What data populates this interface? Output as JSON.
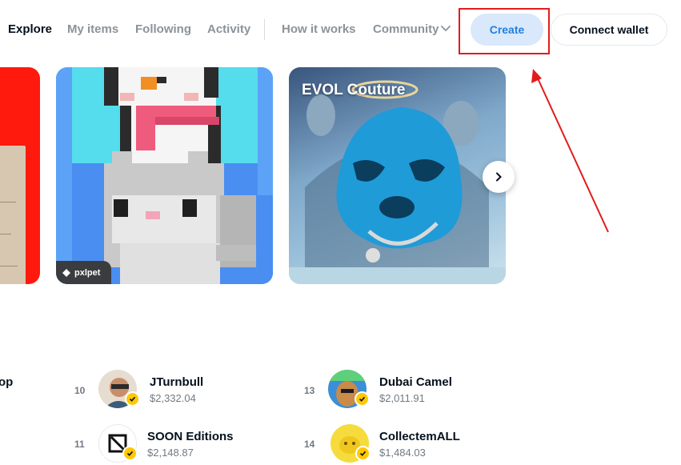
{
  "nav": {
    "explore": "Explore",
    "my_items": "My items",
    "following": "Following",
    "activity": "Activity",
    "how_it_works": "How it works",
    "community": "Community"
  },
  "buttons": {
    "create": "Create",
    "connect_wallet": "Connect wallet"
  },
  "cards": [
    {
      "label": "pxlpet"
    },
    {
      "title": "EVOL Couture"
    }
  ],
  "rankings": {
    "cut_left_text": "op",
    "rows": [
      {
        "rank": "10",
        "name": "JTurnbull",
        "value": "$2,332.04"
      },
      {
        "rank": "11",
        "name": "SOON Editions",
        "value": "$2,148.87"
      },
      {
        "rank": "13",
        "name": "Dubai Camel",
        "value": "$2,011.91"
      },
      {
        "rank": "14",
        "name": "CollectemALL",
        "value": "$1,484.03"
      }
    ]
  },
  "colors": {
    "accent_blue": "#2081e2",
    "create_bg": "#d9e8fb",
    "annotation_red": "#e31b1b",
    "verified_badge": "#ffc800"
  },
  "icons": [
    "chevron-down-icon",
    "chevron-right-icon",
    "verified-badge-icon",
    "pxlpet-logo-icon"
  ]
}
